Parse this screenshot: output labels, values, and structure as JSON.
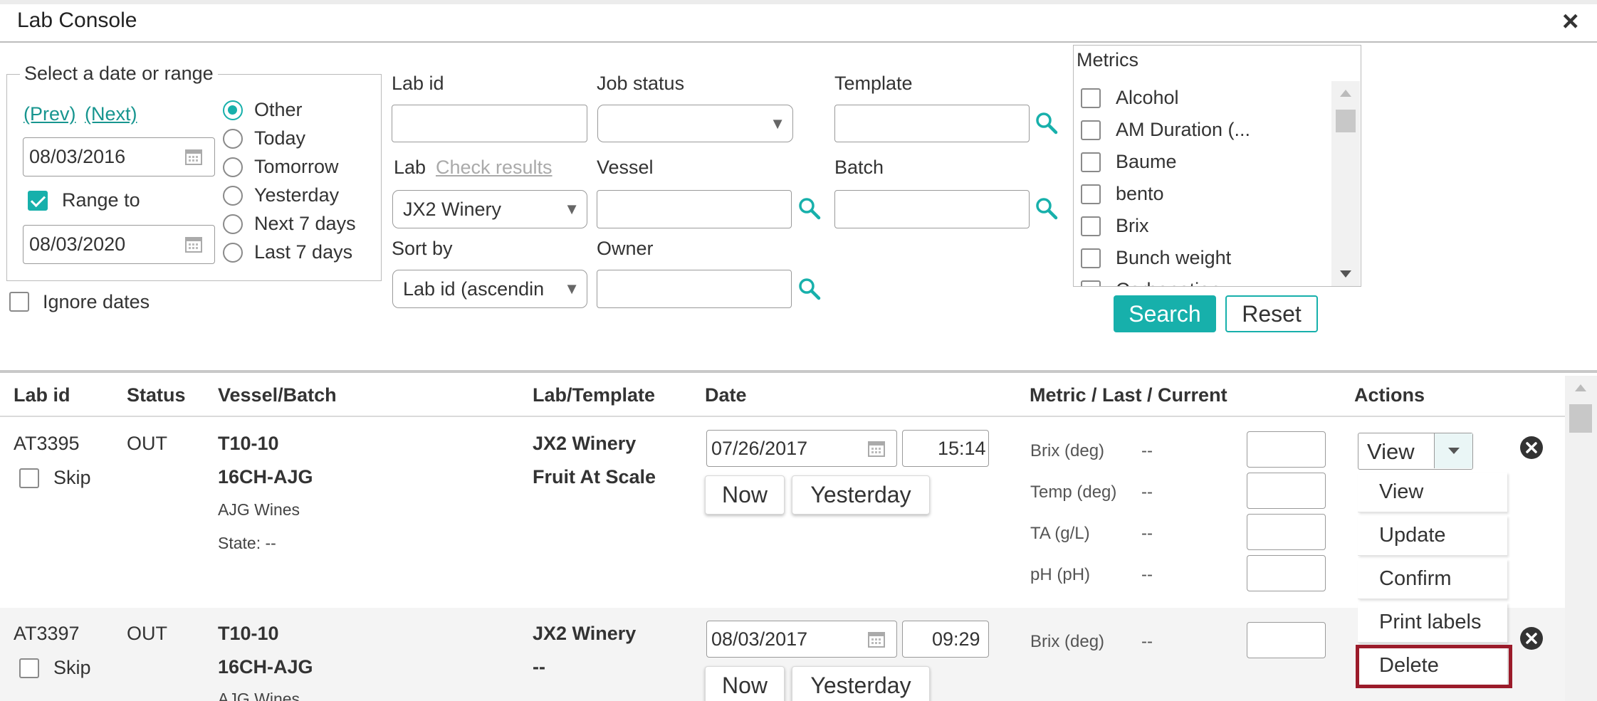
{
  "window": {
    "title": "Lab Console",
    "close": "×"
  },
  "dates": {
    "legend": "Select a date or range",
    "prev": "(Prev)",
    "next": "(Next)",
    "date_from": "08/03/2016",
    "range_label": "Range to",
    "date_to": "08/03/2020",
    "ignore_label": "Ignore dates",
    "options": [
      "Other",
      "Today",
      "Tomorrow",
      "Yesterday",
      "Next 7 days",
      "Last 7 days"
    ],
    "selected": "Other"
  },
  "filters": {
    "lab_id_label": "Lab id",
    "job_status_label": "Job status",
    "template_label": "Template",
    "lab_label": "Lab",
    "check_results": "Check results",
    "lab_value": "JX2 Winery",
    "vessel_label": "Vessel",
    "batch_label": "Batch",
    "sort_label": "Sort by",
    "sort_value": "Lab id (ascendin",
    "owner_label": "Owner"
  },
  "metrics": {
    "title": "Metrics",
    "items": [
      "Alcohol",
      "AM Duration (...",
      "Baume",
      "bento",
      "Brix",
      "Bunch weight",
      "Carbonation"
    ]
  },
  "buttons": {
    "search": "Search",
    "reset": "Reset"
  },
  "table": {
    "headers": [
      "Lab id",
      "Status",
      "Vessel/Batch",
      "Lab/Template",
      "Date",
      "Metric / Last / Current",
      "Actions"
    ],
    "rows": [
      {
        "lab_id": "AT3395",
        "status": "OUT",
        "skip": "Skip",
        "vessel": "T10-10",
        "batch": "16CH-AJG",
        "owner": "AJG Wines",
        "state": "State: --",
        "lab": "JX2 Winery",
        "template": "Fruit At Scale",
        "date": "07/26/2017",
        "time": "15:14",
        "now": "Now",
        "yesterday": "Yesterday",
        "metrics": [
          {
            "name": "Brix (deg)",
            "last": "--"
          },
          {
            "name": "Temp (deg)",
            "last": "--"
          },
          {
            "name": "TA (g/L)",
            "last": "--"
          },
          {
            "name": "pH (pH)",
            "last": "--"
          }
        ],
        "action": "View"
      },
      {
        "lab_id": "AT3397",
        "status": "OUT",
        "skip": "Skip",
        "vessel": "T10-10",
        "batch": "16CH-AJG",
        "owner": "AJG Wines",
        "lab": "JX2 Winery",
        "template": "--",
        "date": "08/03/2017",
        "time": "09:29",
        "now": "Now",
        "yesterday": "Yesterday",
        "metrics": [
          {
            "name": "Brix (deg)",
            "last": "--"
          }
        ]
      }
    ],
    "action_menu": [
      "View",
      "Update",
      "Confirm",
      "Print labels",
      "Delete"
    ]
  },
  "colors": {
    "accent": "#17b0ab",
    "highlight": "#9b1b2a",
    "link": "#17958f"
  }
}
